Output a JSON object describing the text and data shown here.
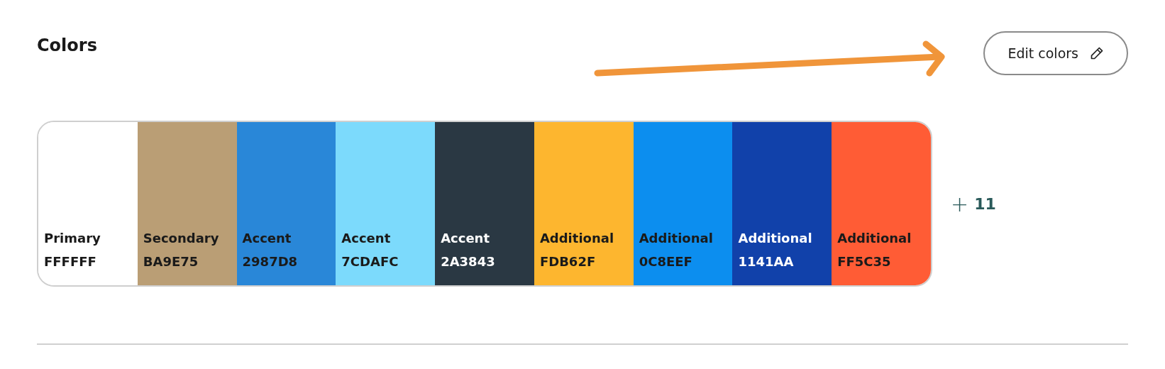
{
  "section": {
    "title": "Colors",
    "edit_button": "Edit colors"
  },
  "swatches": [
    {
      "name": "Primary",
      "hex": "FFFFFF",
      "color": "#ffffff"
    },
    {
      "name": "Secondary",
      "hex": "BA9E75",
      "color": "#ba9e75"
    },
    {
      "name": "Accent",
      "hex": "2987D8",
      "color": "#2987d8"
    },
    {
      "name": "Accent",
      "hex": "7CDAFC",
      "color": "#7cdafc"
    },
    {
      "name": "Accent",
      "hex": "2A3843",
      "color": "#2a3843"
    },
    {
      "name": "Additional",
      "hex": "FDB62F",
      "color": "#fdb62f"
    },
    {
      "name": "Additional",
      "hex": "0C8EEF",
      "color": "#0c8eef"
    },
    {
      "name": "Additional",
      "hex": "1141AA",
      "color": "#1141aa"
    },
    {
      "name": "Additional",
      "hex": "FF5C35",
      "color": "#ff5c35"
    }
  ],
  "more": {
    "symbol": "+",
    "count": "11"
  }
}
